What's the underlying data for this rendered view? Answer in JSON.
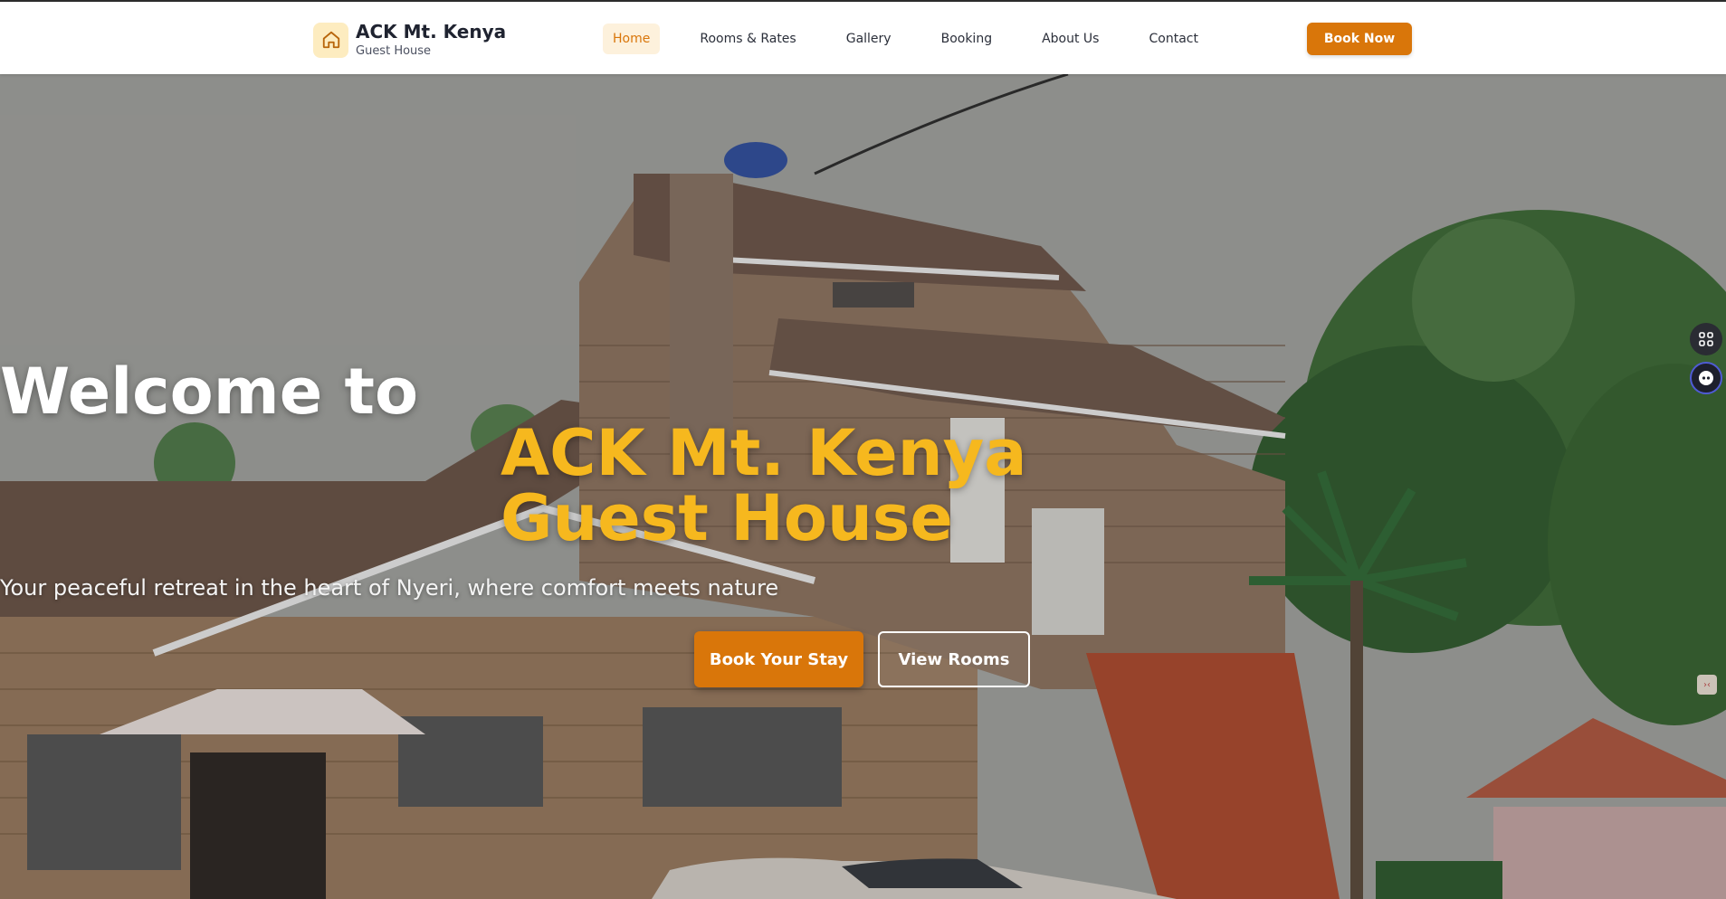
{
  "brand": {
    "name": "ACK Mt. Kenya",
    "subtitle": "Guest House",
    "icon": "home-icon"
  },
  "nav": {
    "items": [
      {
        "label": "Home",
        "active": true
      },
      {
        "label": "Rooms & Rates",
        "active": false
      },
      {
        "label": "Gallery",
        "active": false
      },
      {
        "label": "Booking",
        "active": false
      },
      {
        "label": "About Us",
        "active": false
      },
      {
        "label": "Contact",
        "active": false
      }
    ],
    "cta_label": "Book Now"
  },
  "hero": {
    "title_line1": "Welcome to",
    "title_line2": "ACK Mt. Kenya Guest House",
    "subtitle": "Your peaceful retreat in the heart of Nyeri, where comfort meets nature",
    "primary_button": "Book Your Stay",
    "secondary_button": "View Rooms",
    "background_image": "guest-house-building-photo"
  },
  "widgets": {
    "grid_icon": "apps-grid-icon",
    "bot_icon": "assistant-bot-icon",
    "small_icon": "collapse-icon"
  },
  "colors": {
    "accent": "#d9760a",
    "highlight": "#f6b81e",
    "active_nav_bg": "#fdf1dc"
  }
}
